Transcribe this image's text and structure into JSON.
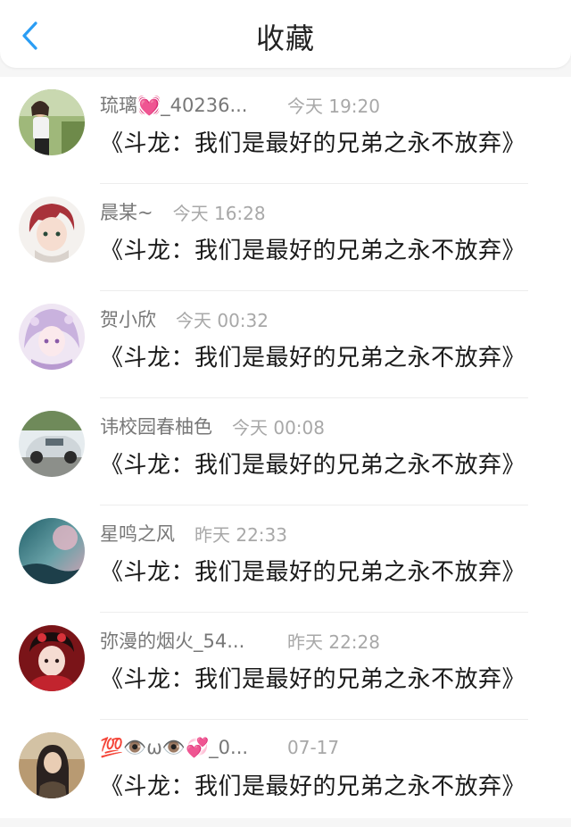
{
  "header": {
    "title": "收藏",
    "back_icon": "chevron-left-icon",
    "accent": "#2a9df4"
  },
  "items": [
    {
      "name": "琉璃💓_40236...",
      "time": "今天 19:20",
      "message": "《斗龙：我们是最好的兄弟之永不放弃》",
      "avatar": "avatar-girl-photo"
    },
    {
      "name": "晨某~",
      "time": "今天 16:28",
      "message": "《斗龙：我们是最好的兄弟之永不放弃》",
      "avatar": "avatar-red-hair-anime"
    },
    {
      "name": "贺小欣",
      "time": "今天 00:32",
      "message": "《斗龙：我们是最好的兄弟之永不放弃》",
      "avatar": "avatar-purple-anime"
    },
    {
      "name": "讳校园春柚色",
      "time": "今天 00:08",
      "message": "《斗龙：我们是最好的兄弟之永不放弃》",
      "avatar": "avatar-car"
    },
    {
      "name": "星鸣之风",
      "time": "昨天 22:33",
      "message": "《斗龙：我们是最好的兄弟之永不放弃》",
      "avatar": "avatar-ocean-pink"
    },
    {
      "name": "弥漫的烟火_54...",
      "time": "昨天 22:28",
      "message": "《斗龙：我们是最好的兄弟之永不放弃》",
      "avatar": "avatar-red-costume"
    },
    {
      "name": "💯👁️ω👁️💞_0...",
      "time": "07-17",
      "message": "《斗龙：我们是最好的兄弟之永不放弃》",
      "avatar": "avatar-ancient-man"
    }
  ]
}
